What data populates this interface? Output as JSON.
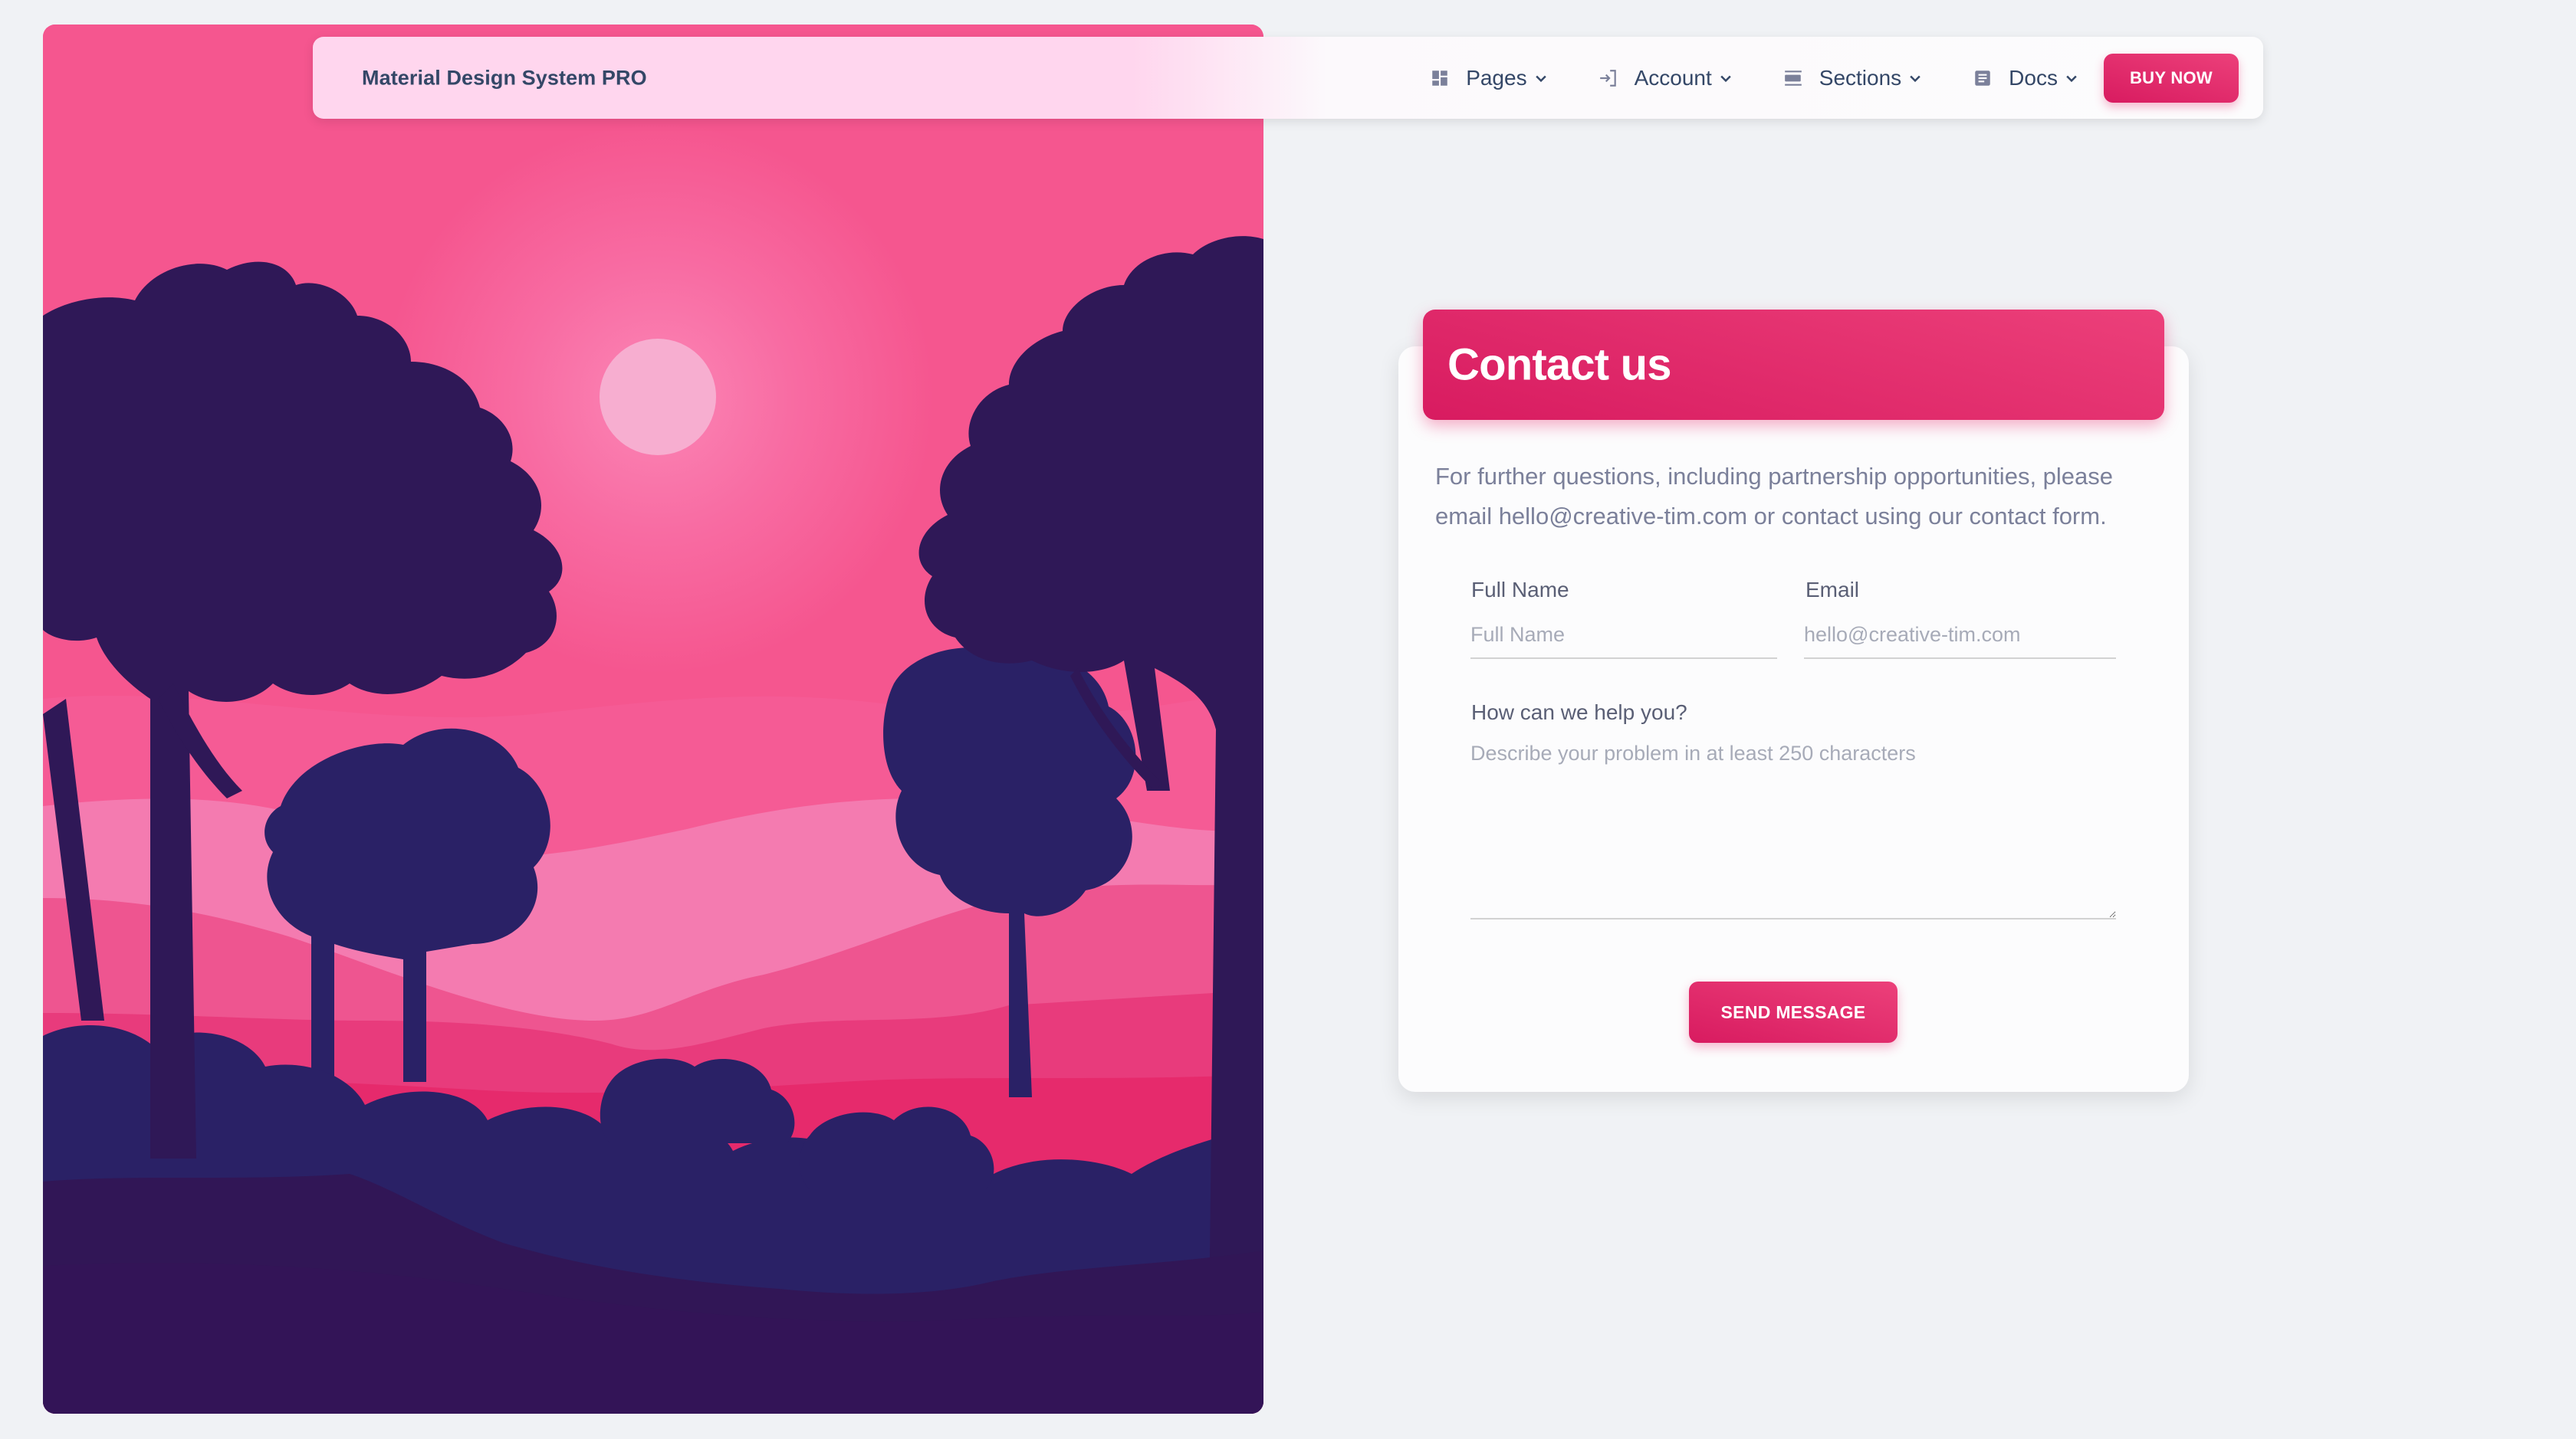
{
  "navbar": {
    "brand": "Material Design System PRO",
    "items": [
      {
        "label": "Pages",
        "icon": "dashboard-icon"
      },
      {
        "label": "Account",
        "icon": "login-icon"
      },
      {
        "label": "Sections",
        "icon": "view-day-icon"
      },
      {
        "label": "Docs",
        "icon": "article-icon"
      }
    ],
    "cta_label": "BUY NOW"
  },
  "hero": {
    "description": "sunset forest illustration with moon and tree silhouettes",
    "colors": {
      "sky": "#f5568f",
      "moon": "#f7aed0",
      "hill_light": "#f47bb0",
      "hill_mid": "#ee5590",
      "hill_deep": "#e83b7c",
      "tree_dark": "#2f1857",
      "tree_blue": "#2a2166",
      "ground": "#311656"
    }
  },
  "contact": {
    "title": "Contact us",
    "description": "For further questions, including partnership opportunities, please email hello@creative-tim.com or contact using our contact form.",
    "fields": {
      "full_name": {
        "label": "Full Name",
        "placeholder": "Full Name",
        "value": ""
      },
      "email": {
        "label": "Email",
        "placeholder": "hello@creative-tim.com",
        "value": ""
      },
      "message": {
        "label": "How can we help you?",
        "placeholder": "Describe your problem in at least 250 characters",
        "value": ""
      }
    },
    "submit_label": "SEND MESSAGE"
  },
  "theme": {
    "primary": "#e91e63",
    "primary_gradient_start": "#ec407a",
    "primary_gradient_end": "#d81b60",
    "text_dark": "#344767",
    "text_muted": "#7b809a",
    "page_bg": "#f0f2f5"
  }
}
